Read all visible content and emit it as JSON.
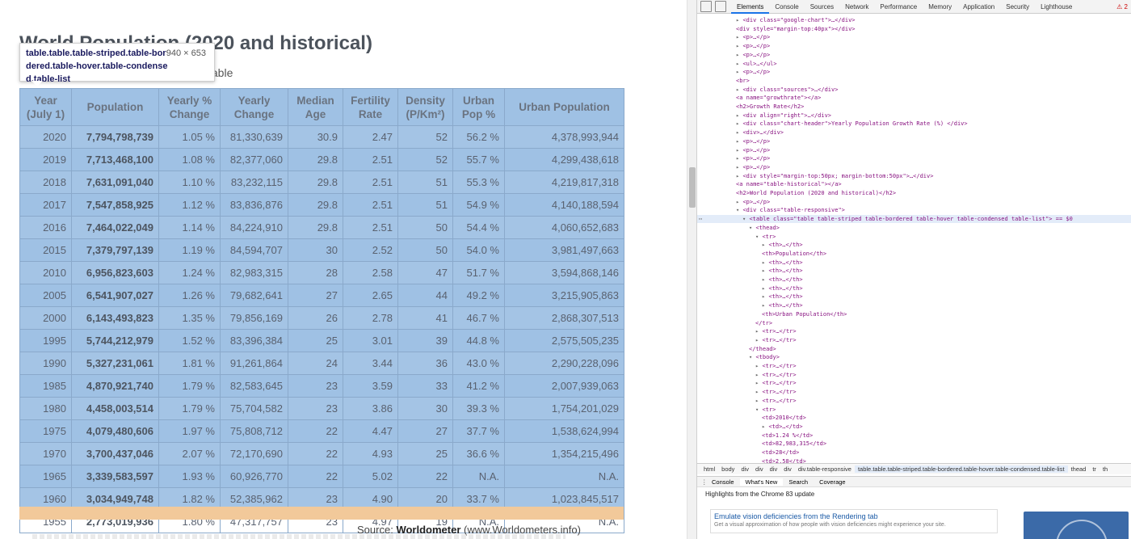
{
  "page": {
    "heading": "World Population (2020 and historical)",
    "subline": "table",
    "tooltip": {
      "selector": "table.table.table-striped.table-bordered.table-hover.table-condensed.table-list",
      "size": "940 × 653"
    },
    "table": {
      "columns": [
        "Year (July 1)",
        "Population",
        "Yearly % Change",
        "Yearly Change",
        "Median Age",
        "Fertility Rate",
        "Density (P/Km²)",
        "Urban Pop %",
        "Urban Population"
      ],
      "rows": [
        [
          "2020",
          "7,794,798,739",
          "1.05 %",
          "81,330,639",
          "30.9",
          "2.47",
          "52",
          "56.2 %",
          "4,378,993,944"
        ],
        [
          "2019",
          "7,713,468,100",
          "1.08 %",
          "82,377,060",
          "29.8",
          "2.51",
          "52",
          "55.7 %",
          "4,299,438,618"
        ],
        [
          "2018",
          "7,631,091,040",
          "1.10 %",
          "83,232,115",
          "29.8",
          "2.51",
          "51",
          "55.3 %",
          "4,219,817,318"
        ],
        [
          "2017",
          "7,547,858,925",
          "1.12 %",
          "83,836,876",
          "29.8",
          "2.51",
          "51",
          "54.9 %",
          "4,140,188,594"
        ],
        [
          "2016",
          "7,464,022,049",
          "1.14 %",
          "84,224,910",
          "29.8",
          "2.51",
          "50",
          "54.4 %",
          "4,060,652,683"
        ],
        [
          "2015",
          "7,379,797,139",
          "1.19 %",
          "84,594,707",
          "30",
          "2.52",
          "50",
          "54.0 %",
          "3,981,497,663"
        ],
        [
          "2010",
          "6,956,823,603",
          "1.24 %",
          "82,983,315",
          "28",
          "2.58",
          "47",
          "51.7 %",
          "3,594,868,146"
        ],
        [
          "2005",
          "6,541,907,027",
          "1.26 %",
          "79,682,641",
          "27",
          "2.65",
          "44",
          "49.2 %",
          "3,215,905,863"
        ],
        [
          "2000",
          "6,143,493,823",
          "1.35 %",
          "79,856,169",
          "26",
          "2.78",
          "41",
          "46.7 %",
          "2,868,307,513"
        ],
        [
          "1995",
          "5,744,212,979",
          "1.52 %",
          "83,396,384",
          "25",
          "3.01",
          "39",
          "44.8 %",
          "2,575,505,235"
        ],
        [
          "1990",
          "5,327,231,061",
          "1.81 %",
          "91,261,864",
          "24",
          "3.44",
          "36",
          "43.0 %",
          "2,290,228,096"
        ],
        [
          "1985",
          "4,870,921,740",
          "1.79 %",
          "82,583,645",
          "23",
          "3.59",
          "33",
          "41.2 %",
          "2,007,939,063"
        ],
        [
          "1980",
          "4,458,003,514",
          "1.79 %",
          "75,704,582",
          "23",
          "3.86",
          "30",
          "39.3 %",
          "1,754,201,029"
        ],
        [
          "1975",
          "4,079,480,606",
          "1.97 %",
          "75,808,712",
          "22",
          "4.47",
          "27",
          "37.7 %",
          "1,538,624,994"
        ],
        [
          "1970",
          "3,700,437,046",
          "2.07 %",
          "72,170,690",
          "22",
          "4.93",
          "25",
          "36.6 %",
          "1,354,215,496"
        ],
        [
          "1965",
          "3,339,583,597",
          "1.93 %",
          "60,926,770",
          "22",
          "5.02",
          "22",
          "N.A.",
          "N.A."
        ],
        [
          "1960",
          "3,034,949,748",
          "1.82 %",
          "52,385,962",
          "23",
          "4.90",
          "20",
          "33.7 %",
          "1,023,845,517"
        ],
        [
          "1955",
          "2,773,019,936",
          "1.80 %",
          "47,317,757",
          "23",
          "4.97",
          "19",
          "N.A.",
          "N.A."
        ]
      ]
    },
    "source_prefix": "Source:",
    "source_name": "Worldometer",
    "source_url": "(www.Worldometers.info)"
  },
  "devtools": {
    "tabs": [
      "Elements",
      "Console",
      "Sources",
      "Network",
      "Performance",
      "Memory",
      "Application",
      "Security",
      "Lighthouse"
    ],
    "active_tab": "Elements",
    "warning_count": "2",
    "dom_lines": [
      {
        "indent": 0,
        "arrow": "▸",
        "text": "<div class=\"google-chart\">…</div>"
      },
      {
        "indent": 0,
        "arrow": "",
        "text": "<div style=\"margin-top:40px\"></div>"
      },
      {
        "indent": 0,
        "arrow": "▸",
        "text": "<p>…</p>"
      },
      {
        "indent": 0,
        "arrow": "▸",
        "text": "<p>…</p>"
      },
      {
        "indent": 0,
        "arrow": "▸",
        "text": "<p>…</p>"
      },
      {
        "indent": 0,
        "arrow": "▸",
        "text": "<ul>…</ul>"
      },
      {
        "indent": 0,
        "arrow": "▸",
        "text": "<p>…</p>"
      },
      {
        "indent": 0,
        "arrow": "",
        "text": "<br>"
      },
      {
        "indent": 0,
        "arrow": "▸",
        "text": "<div class=\"sources\">…</div>"
      },
      {
        "indent": 0,
        "arrow": "",
        "text": "<a name=\"growthrate\"></a>"
      },
      {
        "indent": 0,
        "arrow": "",
        "text": "<h2>Growth Rate</h2>"
      },
      {
        "indent": 0,
        "arrow": "▸",
        "text": "<div align=\"right\">…</div>"
      },
      {
        "indent": 0,
        "arrow": "▸",
        "text": "<div class=\"chart-header\">Yearly Population Growth Rate (%) </div>"
      },
      {
        "indent": 0,
        "arrow": "▸",
        "text": "<div>…</div>"
      },
      {
        "indent": 0,
        "arrow": "▸",
        "text": "<p>…</p>"
      },
      {
        "indent": 0,
        "arrow": "▸",
        "text": "<p>…</p>"
      },
      {
        "indent": 0,
        "arrow": "▸",
        "text": "<p>…</p>"
      },
      {
        "indent": 0,
        "arrow": "▸",
        "text": "<p>…</p>"
      },
      {
        "indent": 0,
        "arrow": "▸",
        "text": "<div style=\"margin-top:50px; margin-bottom:50px\">…</div>"
      },
      {
        "indent": 0,
        "arrow": "",
        "text": "<a name=\"table-historical\"></a>"
      },
      {
        "indent": 0,
        "arrow": "",
        "text": "<h2>World Population (2020 and historical)</h2>"
      },
      {
        "indent": 0,
        "arrow": "▸",
        "text": "<p>…</p>"
      },
      {
        "indent": 0,
        "arrow": "▾",
        "text": "<div class=\"table-responsive\">"
      },
      {
        "indent": 1,
        "arrow": "▾",
        "text": "<table class=\"table table-striped table-bordered table-hover table-condensed table-list\"> == $0",
        "selected": true
      },
      {
        "indent": 2,
        "arrow": "▾",
        "text": "<thead>"
      },
      {
        "indent": 3,
        "arrow": "▾",
        "text": "<tr>"
      },
      {
        "indent": 4,
        "arrow": "▸",
        "text": "<th>…</th>"
      },
      {
        "indent": 4,
        "arrow": "",
        "text": "<th>Population</th>"
      },
      {
        "indent": 4,
        "arrow": "▸",
        "text": "<th>…</th>"
      },
      {
        "indent": 4,
        "arrow": "▸",
        "text": "<th>…</th>"
      },
      {
        "indent": 4,
        "arrow": "▸",
        "text": "<th>…</th>"
      },
      {
        "indent": 4,
        "arrow": "▸",
        "text": "<th>…</th>"
      },
      {
        "indent": 4,
        "arrow": "▸",
        "text": "<th>…</th>"
      },
      {
        "indent": 4,
        "arrow": "▸",
        "text": "<th>…</th>"
      },
      {
        "indent": 4,
        "arrow": "",
        "text": "<th>Urban Population</th>"
      },
      {
        "indent": 3,
        "arrow": "",
        "text": "</tr>"
      },
      {
        "indent": 3,
        "arrow": "▸",
        "text": "<tr>…</tr>"
      },
      {
        "indent": 3,
        "arrow": "▸",
        "text": "<tr>…</tr>"
      },
      {
        "indent": 2,
        "arrow": "",
        "text": "</thead>"
      },
      {
        "indent": 2,
        "arrow": "▾",
        "text": "<tbody>"
      },
      {
        "indent": 3,
        "arrow": "▸",
        "text": "<tr>…</tr>"
      },
      {
        "indent": 3,
        "arrow": "▸",
        "text": "<tr>…</tr>"
      },
      {
        "indent": 3,
        "arrow": "▸",
        "text": "<tr>…</tr>"
      },
      {
        "indent": 3,
        "arrow": "▸",
        "text": "<tr>…</tr>"
      },
      {
        "indent": 3,
        "arrow": "▸",
        "text": "<tr>…</tr>"
      },
      {
        "indent": 3,
        "arrow": "▾",
        "text": "<tr>"
      },
      {
        "indent": 4,
        "arrow": "",
        "text": "<td>2010</td>"
      },
      {
        "indent": 4,
        "arrow": "▸",
        "text": "<td>…</td>"
      },
      {
        "indent": 4,
        "arrow": "",
        "text": "<td>1.24 %</td>"
      },
      {
        "indent": 4,
        "arrow": "",
        "text": "<td>82,983,315</td>"
      },
      {
        "indent": 4,
        "arrow": "",
        "text": "<td>28</td>"
      },
      {
        "indent": 4,
        "arrow": "",
        "text": "<td>2.58</td>"
      }
    ],
    "breadcrumb": [
      "html",
      "body",
      "div",
      "div",
      "div",
      "div",
      "div.table-responsive",
      "table.table.table-striped.table-bordered.table-hover.table-condensed.table-list",
      "thead",
      "tr",
      "th"
    ],
    "breadcrumb_current": "table.table.table-striped.table-bordered.table-hover.table-condensed.table-list",
    "drawer_tabs": [
      "Console",
      "What's New",
      "Search",
      "Coverage"
    ],
    "drawer_active": "What's New",
    "highlights": "Highlights from the Chrome 83 update",
    "card_title": "Emulate vision deficiencies from the Rendering tab",
    "card_desc": "Get a visual approximation of how people with vision deficiencies might experience your site."
  }
}
